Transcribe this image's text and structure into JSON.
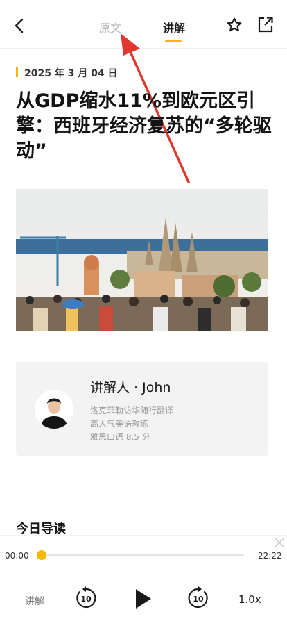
{
  "header": {
    "tab_original": "原文",
    "tab_explain": "讲解",
    "accent_color": "#f5b800"
  },
  "article": {
    "date": "2025 年 3 月 04 日",
    "title": "从GDP缩水11%到欧元区引擎：西班牙经济复苏的“多轮驱动”",
    "section_heading": "今日导读"
  },
  "narrator": {
    "name": "讲解人 · John",
    "credentials": [
      "洛克菲勒访华随行翻译",
      "高人气美语教练",
      "雅思口语 8.5 分"
    ]
  },
  "player": {
    "current_time": "00:00",
    "total_time": "22:22",
    "progress": 0,
    "mode_label": "讲解",
    "rewind_seconds": "10",
    "forward_seconds": "10",
    "speed": "1.0x"
  },
  "icons": [
    "back-arrow-icon",
    "star-icon",
    "share-icon",
    "close-icon",
    "rewind-10-icon",
    "play-icon",
    "forward-10-icon"
  ]
}
